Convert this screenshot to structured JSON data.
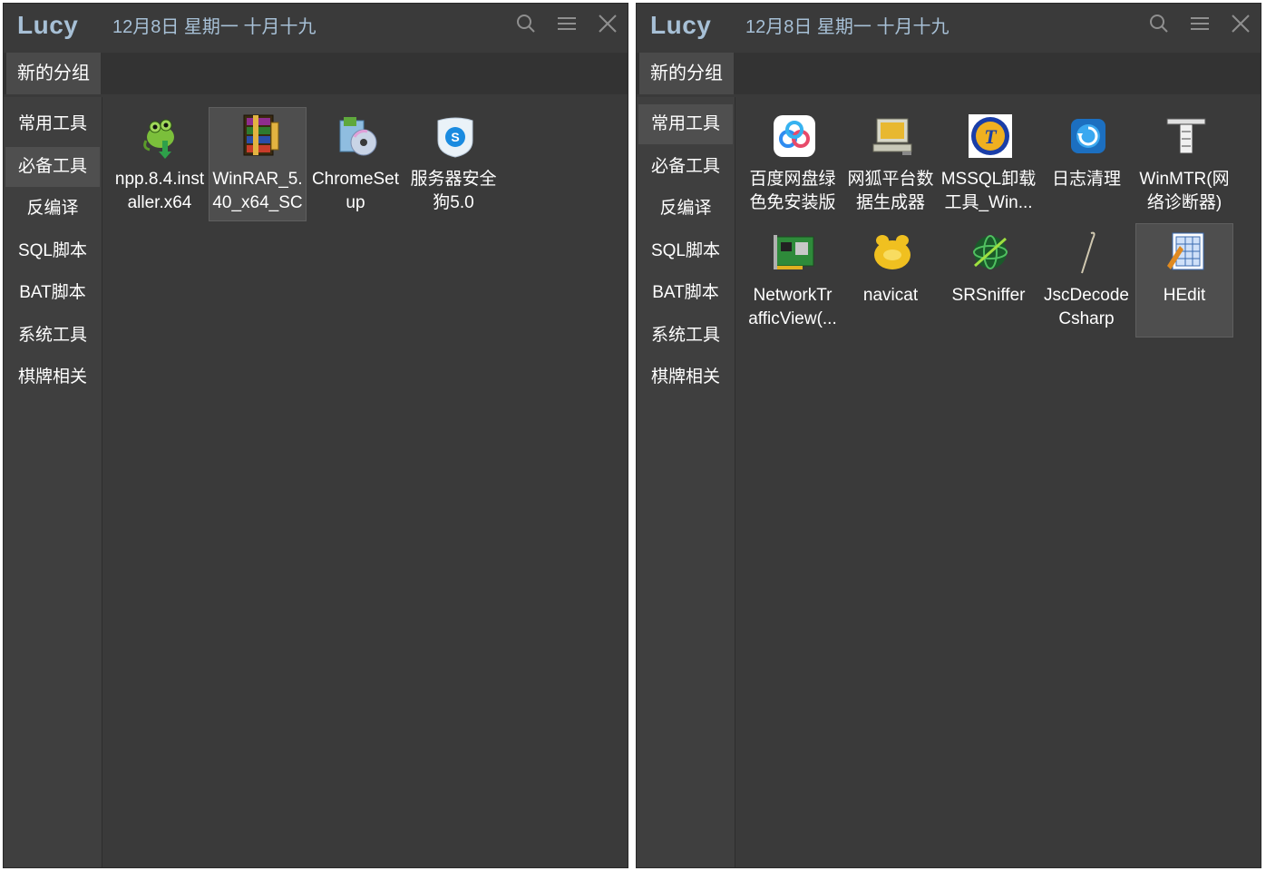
{
  "windows": [
    {
      "app_title": "Lucy",
      "date": "12月8日 星期一 十月十九",
      "group_tab": "新的分组",
      "categories": [
        {
          "label": "常用工具",
          "active": false
        },
        {
          "label": "必备工具",
          "active": true
        },
        {
          "label": "反编译",
          "active": false
        },
        {
          "label": "SQL脚本",
          "active": false
        },
        {
          "label": "BAT脚本",
          "active": false
        },
        {
          "label": "系统工具",
          "active": false
        },
        {
          "label": "棋牌相关",
          "active": false
        }
      ],
      "apps": [
        {
          "label": "npp.8.4.inst\naller.x64",
          "icon": "notepad-plus-plus-chameleon-icon"
        },
        {
          "label": "WinRAR_5.\n40_x64_SC",
          "icon": "winrar-books-icon",
          "selected": true
        },
        {
          "label": "ChromeSet\nup",
          "icon": "installer-cd-icon"
        },
        {
          "label": "服务器安全\n狗5.0",
          "icon": "safedog-shield-icon"
        }
      ]
    },
    {
      "app_title": "Lucy",
      "date": "12月8日 星期一 十月十九",
      "group_tab": "新的分组",
      "categories": [
        {
          "label": "常用工具",
          "active": true
        },
        {
          "label": "必备工具",
          "active": false
        },
        {
          "label": "反编译",
          "active": false
        },
        {
          "label": "SQL脚本",
          "active": false
        },
        {
          "label": "BAT脚本",
          "active": false
        },
        {
          "label": "系统工具",
          "active": false
        },
        {
          "label": "棋牌相关",
          "active": false
        }
      ],
      "apps": [
        {
          "label": "百度网盘绿\n色免安装版",
          "icon": "baidu-netdisk-cloud-icon"
        },
        {
          "label": "网狐平台数\n据生成器",
          "icon": "computer-monitor-icon"
        },
        {
          "label": "MSSQL卸载\n工具_Win...",
          "icon": "mssql-uninstall-logo-icon"
        },
        {
          "label": "日志清理",
          "icon": "log-cleaner-icon"
        },
        {
          "label": "WinMTR(网\n络诊断器)",
          "icon": "network-tower-icon"
        },
        {
          "label": "NetworkTr\nafficView(...",
          "icon": "network-card-icon"
        },
        {
          "label": "navicat",
          "icon": "navicat-icon"
        },
        {
          "label": "SRSniffer",
          "icon": "srsniffer-globe-icon"
        },
        {
          "label": "JscDecode\nCsharp",
          "icon": "hook-icon"
        },
        {
          "label": "HEdit",
          "icon": "hex-editor-icon",
          "selected": true
        }
      ]
    }
  ]
}
